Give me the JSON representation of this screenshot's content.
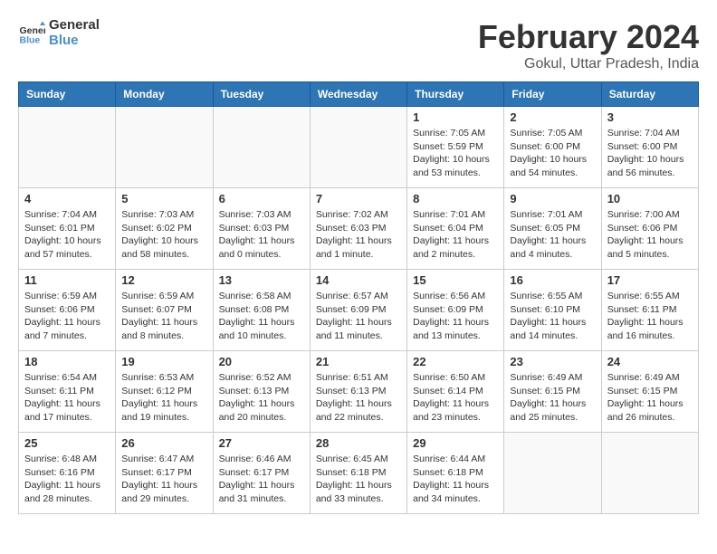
{
  "logo": {
    "text_general": "General",
    "text_blue": "Blue"
  },
  "title": "February 2024",
  "subtitle": "Gokul, Uttar Pradesh, India",
  "weekdays": [
    "Sunday",
    "Monday",
    "Tuesday",
    "Wednesday",
    "Thursday",
    "Friday",
    "Saturday"
  ],
  "weeks": [
    [
      null,
      null,
      null,
      null,
      {
        "day": "1",
        "sunrise": "7:05 AM",
        "sunset": "5:59 PM",
        "daylight": "10 hours and 53 minutes."
      },
      {
        "day": "2",
        "sunrise": "7:05 AM",
        "sunset": "6:00 PM",
        "daylight": "10 hours and 54 minutes."
      },
      {
        "day": "3",
        "sunrise": "7:04 AM",
        "sunset": "6:00 PM",
        "daylight": "10 hours and 56 minutes."
      }
    ],
    [
      {
        "day": "4",
        "sunrise": "7:04 AM",
        "sunset": "6:01 PM",
        "daylight": "10 hours and 57 minutes."
      },
      {
        "day": "5",
        "sunrise": "7:03 AM",
        "sunset": "6:02 PM",
        "daylight": "10 hours and 58 minutes."
      },
      {
        "day": "6",
        "sunrise": "7:03 AM",
        "sunset": "6:03 PM",
        "daylight": "11 hours and 0 minutes."
      },
      {
        "day": "7",
        "sunrise": "7:02 AM",
        "sunset": "6:03 PM",
        "daylight": "11 hours and 1 minute."
      },
      {
        "day": "8",
        "sunrise": "7:01 AM",
        "sunset": "6:04 PM",
        "daylight": "11 hours and 2 minutes."
      },
      {
        "day": "9",
        "sunrise": "7:01 AM",
        "sunset": "6:05 PM",
        "daylight": "11 hours and 4 minutes."
      },
      {
        "day": "10",
        "sunrise": "7:00 AM",
        "sunset": "6:06 PM",
        "daylight": "11 hours and 5 minutes."
      }
    ],
    [
      {
        "day": "11",
        "sunrise": "6:59 AM",
        "sunset": "6:06 PM",
        "daylight": "11 hours and 7 minutes."
      },
      {
        "day": "12",
        "sunrise": "6:59 AM",
        "sunset": "6:07 PM",
        "daylight": "11 hours and 8 minutes."
      },
      {
        "day": "13",
        "sunrise": "6:58 AM",
        "sunset": "6:08 PM",
        "daylight": "11 hours and 10 minutes."
      },
      {
        "day": "14",
        "sunrise": "6:57 AM",
        "sunset": "6:09 PM",
        "daylight": "11 hours and 11 minutes."
      },
      {
        "day": "15",
        "sunrise": "6:56 AM",
        "sunset": "6:09 PM",
        "daylight": "11 hours and 13 minutes."
      },
      {
        "day": "16",
        "sunrise": "6:55 AM",
        "sunset": "6:10 PM",
        "daylight": "11 hours and 14 minutes."
      },
      {
        "day": "17",
        "sunrise": "6:55 AM",
        "sunset": "6:11 PM",
        "daylight": "11 hours and 16 minutes."
      }
    ],
    [
      {
        "day": "18",
        "sunrise": "6:54 AM",
        "sunset": "6:11 PM",
        "daylight": "11 hours and 17 minutes."
      },
      {
        "day": "19",
        "sunrise": "6:53 AM",
        "sunset": "6:12 PM",
        "daylight": "11 hours and 19 minutes."
      },
      {
        "day": "20",
        "sunrise": "6:52 AM",
        "sunset": "6:13 PM",
        "daylight": "11 hours and 20 minutes."
      },
      {
        "day": "21",
        "sunrise": "6:51 AM",
        "sunset": "6:13 PM",
        "daylight": "11 hours and 22 minutes."
      },
      {
        "day": "22",
        "sunrise": "6:50 AM",
        "sunset": "6:14 PM",
        "daylight": "11 hours and 23 minutes."
      },
      {
        "day": "23",
        "sunrise": "6:49 AM",
        "sunset": "6:15 PM",
        "daylight": "11 hours and 25 minutes."
      },
      {
        "day": "24",
        "sunrise": "6:49 AM",
        "sunset": "6:15 PM",
        "daylight": "11 hours and 26 minutes."
      }
    ],
    [
      {
        "day": "25",
        "sunrise": "6:48 AM",
        "sunset": "6:16 PM",
        "daylight": "11 hours and 28 minutes."
      },
      {
        "day": "26",
        "sunrise": "6:47 AM",
        "sunset": "6:17 PM",
        "daylight": "11 hours and 29 minutes."
      },
      {
        "day": "27",
        "sunrise": "6:46 AM",
        "sunset": "6:17 PM",
        "daylight": "11 hours and 31 minutes."
      },
      {
        "day": "28",
        "sunrise": "6:45 AM",
        "sunset": "6:18 PM",
        "daylight": "11 hours and 33 minutes."
      },
      {
        "day": "29",
        "sunrise": "6:44 AM",
        "sunset": "6:18 PM",
        "daylight": "11 hours and 34 minutes."
      },
      null,
      null
    ]
  ]
}
